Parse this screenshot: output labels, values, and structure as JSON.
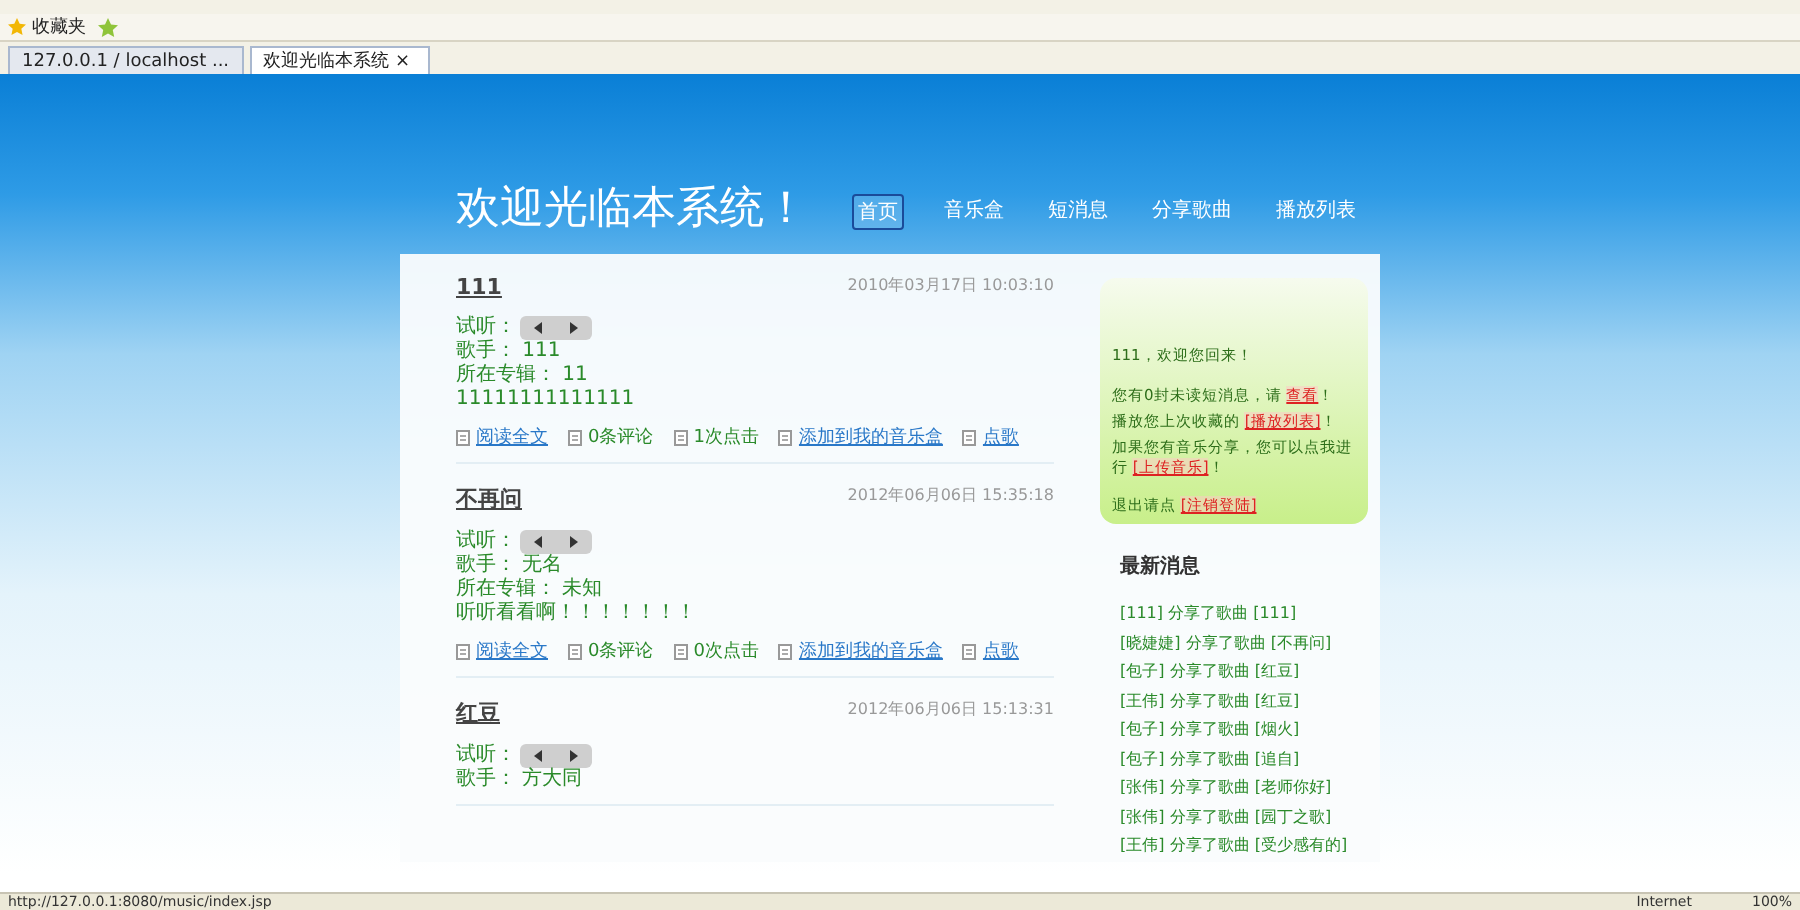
{
  "browser": {
    "favorites": "收藏夹",
    "close": "×",
    "tabs": [
      {
        "label": "127.0.0.1 / localhost ...",
        "selected": false
      },
      {
        "label": "欢迎光临本系统",
        "selected": true
      }
    ],
    "status_url": "http://127.0.0.1:8080/music/index.jsp",
    "status_zone": "Internet",
    "zoom": "100%"
  },
  "header": {
    "title": "欢迎光临本系统！",
    "nav": [
      {
        "label": "首页",
        "selected": true
      },
      {
        "label": "音乐盒",
        "selected": false
      },
      {
        "label": "短消息",
        "selected": false
      },
      {
        "label": "分享歌曲",
        "selected": false
      },
      {
        "label": "播放列表",
        "selected": false
      }
    ]
  },
  "posts": [
    {
      "title": "111",
      "date": "2010年03月17日 10:03:10",
      "listen": "试听：",
      "fields": [
        "歌手： 111",
        "所在专辑： 11",
        "11111111111111"
      ],
      "actions": [
        {
          "kind": "link",
          "label": "阅读全文"
        },
        {
          "kind": "text",
          "label": "0条评论"
        },
        {
          "kind": "text",
          "label": "1次点击"
        },
        {
          "kind": "link",
          "label": "添加到我的音乐盒"
        },
        {
          "kind": "link",
          "label": "点歌"
        }
      ]
    },
    {
      "title": "不再问",
      "date": "2012年06月06日 15:35:18",
      "listen": "试听：",
      "fields": [
        "歌手： 无名",
        "所在专辑： 未知",
        "听听看看啊！！！！！！！"
      ],
      "actions": [
        {
          "kind": "link",
          "label": "阅读全文"
        },
        {
          "kind": "text",
          "label": "0条评论"
        },
        {
          "kind": "text",
          "label": "0次点击"
        },
        {
          "kind": "link",
          "label": "添加到我的音乐盒"
        },
        {
          "kind": "link",
          "label": "点歌"
        }
      ]
    },
    {
      "title": "红豆",
      "date": "2012年06月06日 15:13:31",
      "listen": "试听：",
      "fields": [
        "歌手： 方大同"
      ]
    }
  ],
  "welcome": {
    "greeting": "111，欢迎您回来！",
    "lines": [
      {
        "before": "您有0封未读短消息，请",
        "link": "查看",
        "after": "！"
      },
      {
        "before": "播放您上次收藏的",
        "link": "[播放列表]",
        "after": "！"
      },
      {
        "before": "加果您有音乐分享，您可以点我进行",
        "link": "[上传音乐]",
        "after": "！"
      },
      {
        "before": "退出请点",
        "link": "[注销登陆]"
      }
    ]
  },
  "news": {
    "title": "最新消息",
    "items": [
      "[111] 分享了歌曲 [111]",
      "[晓婕婕] 分享了歌曲 [不再问]",
      "[包子] 分享了歌曲 [红豆]",
      "[王伟] 分享了歌曲 [红豆]",
      "[包子] 分享了歌曲 [烟火]",
      "[包子] 分享了歌曲 [追自]",
      "[张伟] 分享了歌曲 [老师你好]",
      "[张伟] 分享了歌曲 [园丁之歌]",
      "[王伟] 分享了歌曲 [受少感有的]"
    ]
  }
}
